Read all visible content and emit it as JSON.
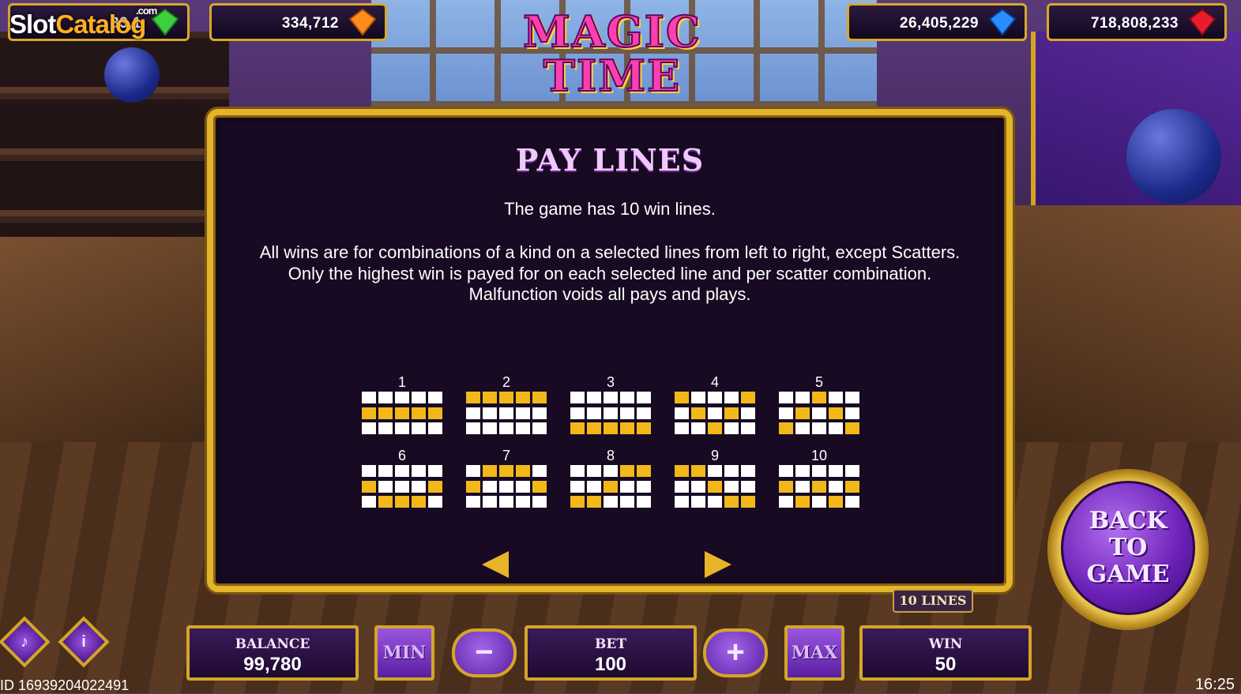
{
  "watermark": {
    "slot": "Slot",
    "catalog": "Catalog",
    "com": ".com"
  },
  "jackpots": [
    {
      "value": "33,1",
      "gem": "green-gem-icon",
      "color": "#3ecf3e"
    },
    {
      "value": "334,712",
      "gem": "orange-gem-icon",
      "color": "#ff8c1a"
    },
    {
      "value": "26,405,229",
      "gem": "blue-gem-icon",
      "color": "#2a8cff"
    },
    {
      "value": "718,808,233",
      "gem": "red-gem-icon",
      "color": "#e81c2c"
    }
  ],
  "logo": {
    "line1": "MAGIC",
    "line2": "TIME"
  },
  "paytable": {
    "title": "PAY LINES",
    "intro": "The game has 10 win lines.",
    "rules": [
      "All wins are for combinations of a kind on a selected lines from left to right, except Scatters.",
      "Only the highest win is payed for on each selected line and per scatter combination.",
      "Malfunction voids all pays and plays."
    ],
    "lines": [
      {
        "num": "1",
        "rows": [
          1,
          1,
          1,
          1,
          1
        ]
      },
      {
        "num": "2",
        "rows": [
          0,
          0,
          0,
          0,
          0
        ]
      },
      {
        "num": "3",
        "rows": [
          2,
          2,
          2,
          2,
          2
        ]
      },
      {
        "num": "4",
        "rows": [
          0,
          1,
          2,
          1,
          0
        ]
      },
      {
        "num": "5",
        "rows": [
          2,
          1,
          0,
          1,
          2
        ]
      },
      {
        "num": "6",
        "rows": [
          1,
          2,
          2,
          2,
          1
        ]
      },
      {
        "num": "7",
        "rows": [
          1,
          0,
          0,
          0,
          1
        ]
      },
      {
        "num": "8",
        "rows": [
          2,
          2,
          1,
          0,
          0
        ]
      },
      {
        "num": "9",
        "rows": [
          0,
          0,
          1,
          2,
          2
        ]
      },
      {
        "num": "10",
        "rows": [
          1,
          2,
          1,
          2,
          1
        ]
      }
    ]
  },
  "lines_badge": "10 LINES",
  "back_button": {
    "line1": "BACK",
    "line2": "TO",
    "line3": "GAME"
  },
  "bottom": {
    "balance_label": "BALANCE",
    "balance_value": "99,780",
    "min_label": "MIN",
    "bet_label": "BET",
    "bet_value": "100",
    "max_label": "MAX",
    "win_label": "WIN",
    "win_value": "50",
    "minus": "−",
    "plus": "+"
  },
  "footer": {
    "id": "ID 16939204022491",
    "time": "16:25"
  }
}
